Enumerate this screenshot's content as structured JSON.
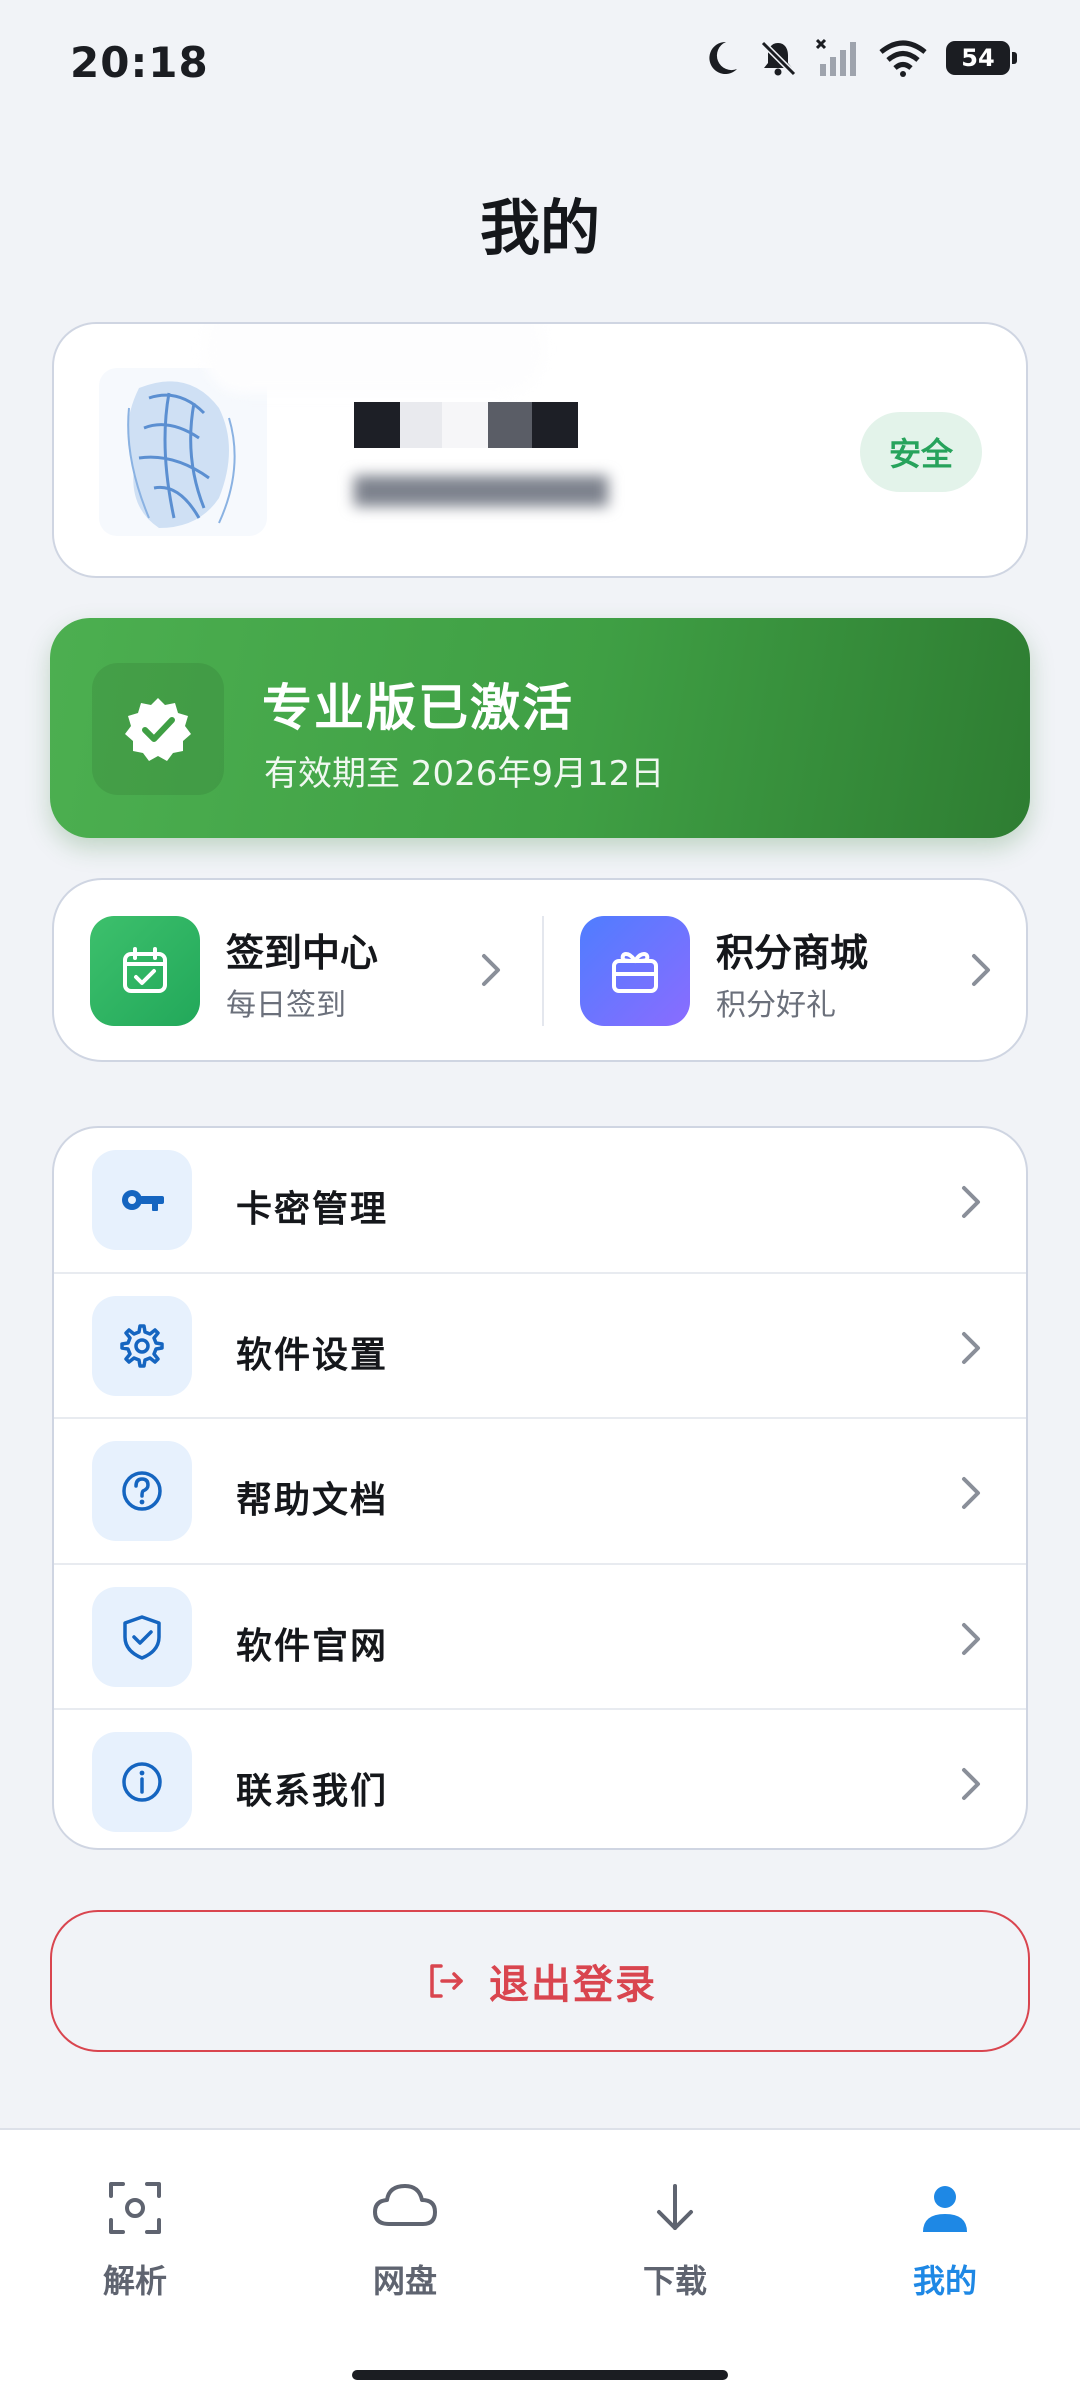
{
  "status_bar": {
    "time": "20:18",
    "battery": "54",
    "icons": [
      "moon-icon",
      "bell-muted-icon",
      "signal-icon",
      "wifi-icon",
      "battery-icon"
    ]
  },
  "page_title": "我的",
  "profile": {
    "status_badge": "安全",
    "avatar": "sketch-portrait-avatar"
  },
  "pro_banner": {
    "title": "专业版已激活",
    "subtitle": "有效期至 2026年9月12日",
    "icon": "verified-badge-icon"
  },
  "quick_actions": [
    {
      "title": "签到中心",
      "subtitle": "每日签到",
      "icon": "calendar-check-icon"
    },
    {
      "title": "积分商城",
      "subtitle": "积分好礼",
      "icon": "gift-icon"
    }
  ],
  "menu": [
    {
      "label": "卡密管理",
      "icon": "key-icon"
    },
    {
      "label": "软件设置",
      "icon": "gear-icon"
    },
    {
      "label": "帮助文档",
      "icon": "help-circle-icon"
    },
    {
      "label": "软件官网",
      "icon": "shield-check-icon"
    },
    {
      "label": "联系我们",
      "icon": "info-circle-icon"
    }
  ],
  "logout_label": "退出登录",
  "bottom_nav": [
    {
      "label": "解析",
      "icon": "scan-icon",
      "active": false
    },
    {
      "label": "网盘",
      "icon": "cloud-icon",
      "active": false
    },
    {
      "label": "下载",
      "icon": "download-arrow-icon",
      "active": false
    },
    {
      "label": "我的",
      "icon": "person-icon",
      "active": true
    }
  ],
  "colors": {
    "accent_blue": "#1e88e5",
    "pro_green": "#4caf50",
    "danger_red": "#d9454f",
    "safe_green": "#27a35c"
  }
}
